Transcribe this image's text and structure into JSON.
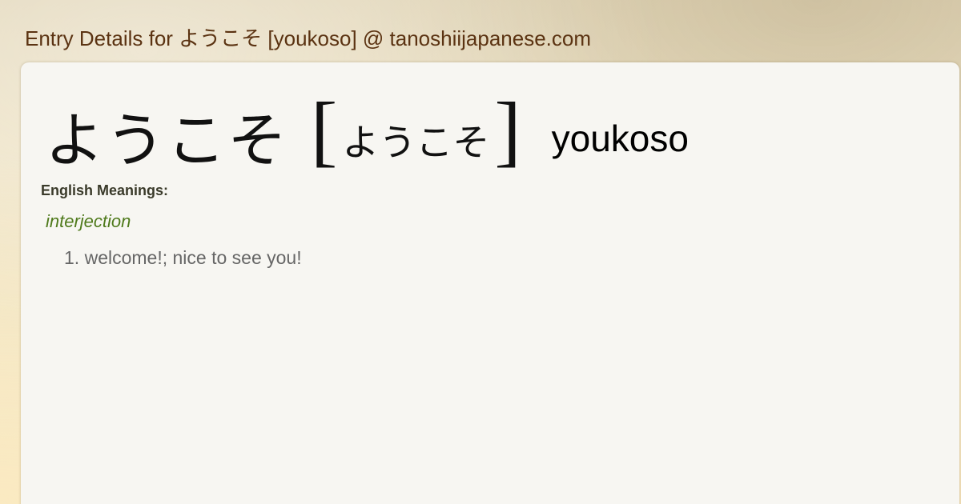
{
  "header": {
    "title": "Entry Details for ようこそ [youkoso] @ tanoshiijapanese.com"
  },
  "entry": {
    "word": "ようこそ",
    "bracket_open": "[",
    "reading": "ようこそ",
    "bracket_close": "]",
    "romaji": "youkoso",
    "meanings_label": "English Meanings:",
    "part_of_speech": "interjection",
    "meanings": [
      {
        "number": "1.",
        "text": "welcome!; nice to see you!"
      }
    ]
  },
  "colors": {
    "header_text": "#5b3312",
    "part_of_speech": "#4f7a1c",
    "meaning_text": "#666666",
    "panel_background": "#f7f6f2"
  }
}
